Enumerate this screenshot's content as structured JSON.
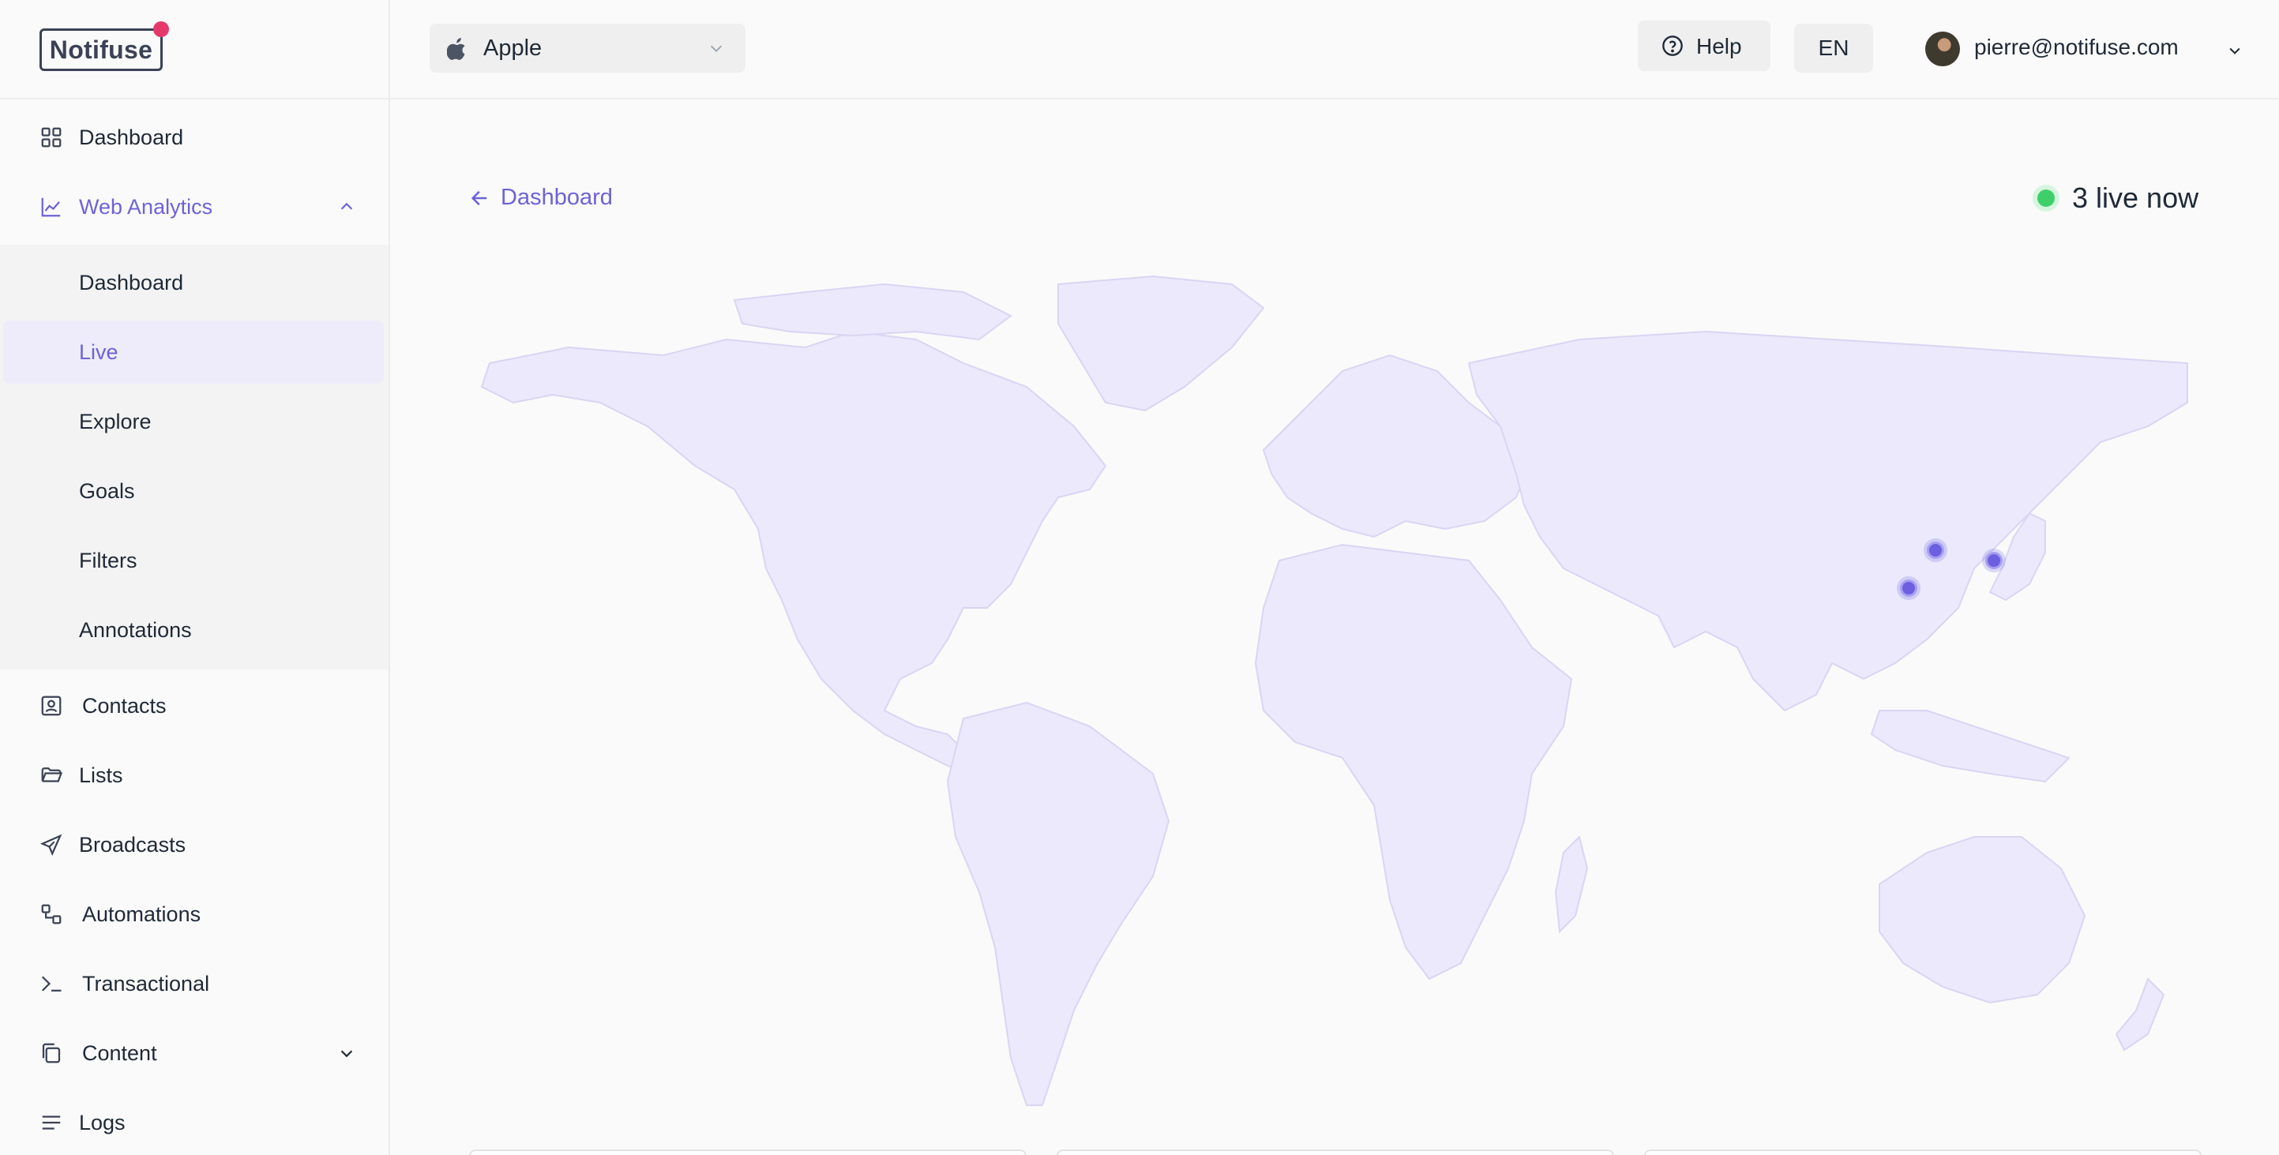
{
  "app": {
    "brand": "Notifuse",
    "accent_color": "#6c63d8",
    "notification_dot_color": "#e5396c"
  },
  "sidebar": {
    "items": [
      {
        "label": "Dashboard",
        "icon": "grid-icon"
      },
      {
        "label": "Web Analytics",
        "icon": "line-chart-icon",
        "expanded": true,
        "children": [
          {
            "label": "Dashboard"
          },
          {
            "label": "Live",
            "selected": true
          },
          {
            "label": "Explore"
          },
          {
            "label": "Goals"
          },
          {
            "label": "Filters"
          },
          {
            "label": "Annotations"
          }
        ]
      },
      {
        "label": "Contacts",
        "icon": "contact-card-icon"
      },
      {
        "label": "Lists",
        "icon": "folder-open-icon"
      },
      {
        "label": "Broadcasts",
        "icon": "paper-plane-icon"
      },
      {
        "label": "Automations",
        "icon": "workflow-icon"
      },
      {
        "label": "Transactional",
        "icon": "terminal-icon"
      },
      {
        "label": "Content",
        "icon": "copy-icon",
        "expanded": false
      },
      {
        "label": "Logs",
        "icon": "list-icon"
      }
    ]
  },
  "header": {
    "project": {
      "name": "Apple",
      "icon": "apple-icon"
    },
    "help_label": "Help",
    "language": "EN",
    "user_email": "pierre@notifuse.com"
  },
  "main": {
    "back_label": "Dashboard",
    "live_label": "3 live now",
    "live_color": "#3fcf6a",
    "map": {
      "land_color": "#ebe9fb",
      "visitor_color": "#6c5fe0",
      "visitors_shown": 3
    }
  }
}
